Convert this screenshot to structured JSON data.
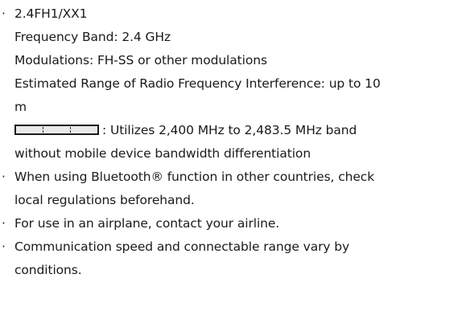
{
  "bullet_glyph": "·",
  "spec": {
    "code": "2.4FH1/XX1",
    "frequency_band": "Frequency Band: 2.4 GHz",
    "modulations": "Modulations: FH-SS or other modulations",
    "range_line1": "Estimated Range of Radio Frequency Interference: up to 10",
    "range_line2": "m",
    "band_desc_line1": ": Utilizes 2,400 MHz to 2,483.5 MHz band",
    "band_desc_line2": "without mobile device bandwidth differentiation"
  },
  "notes": [
    {
      "line1": "When using Bluetooth® function in other countries, check",
      "line2": "local regulations beforehand."
    },
    {
      "line1": "For use in an airplane, contact your airline.",
      "line2": ""
    },
    {
      "line1": "Communication speed and connectable range vary by",
      "line2": "conditions."
    }
  ],
  "colors": {
    "text": "#1a1a1a",
    "band_fill": "#e9e9e9"
  },
  "icons": {
    "band_diagram": "frequency-band-diagram-icon"
  }
}
